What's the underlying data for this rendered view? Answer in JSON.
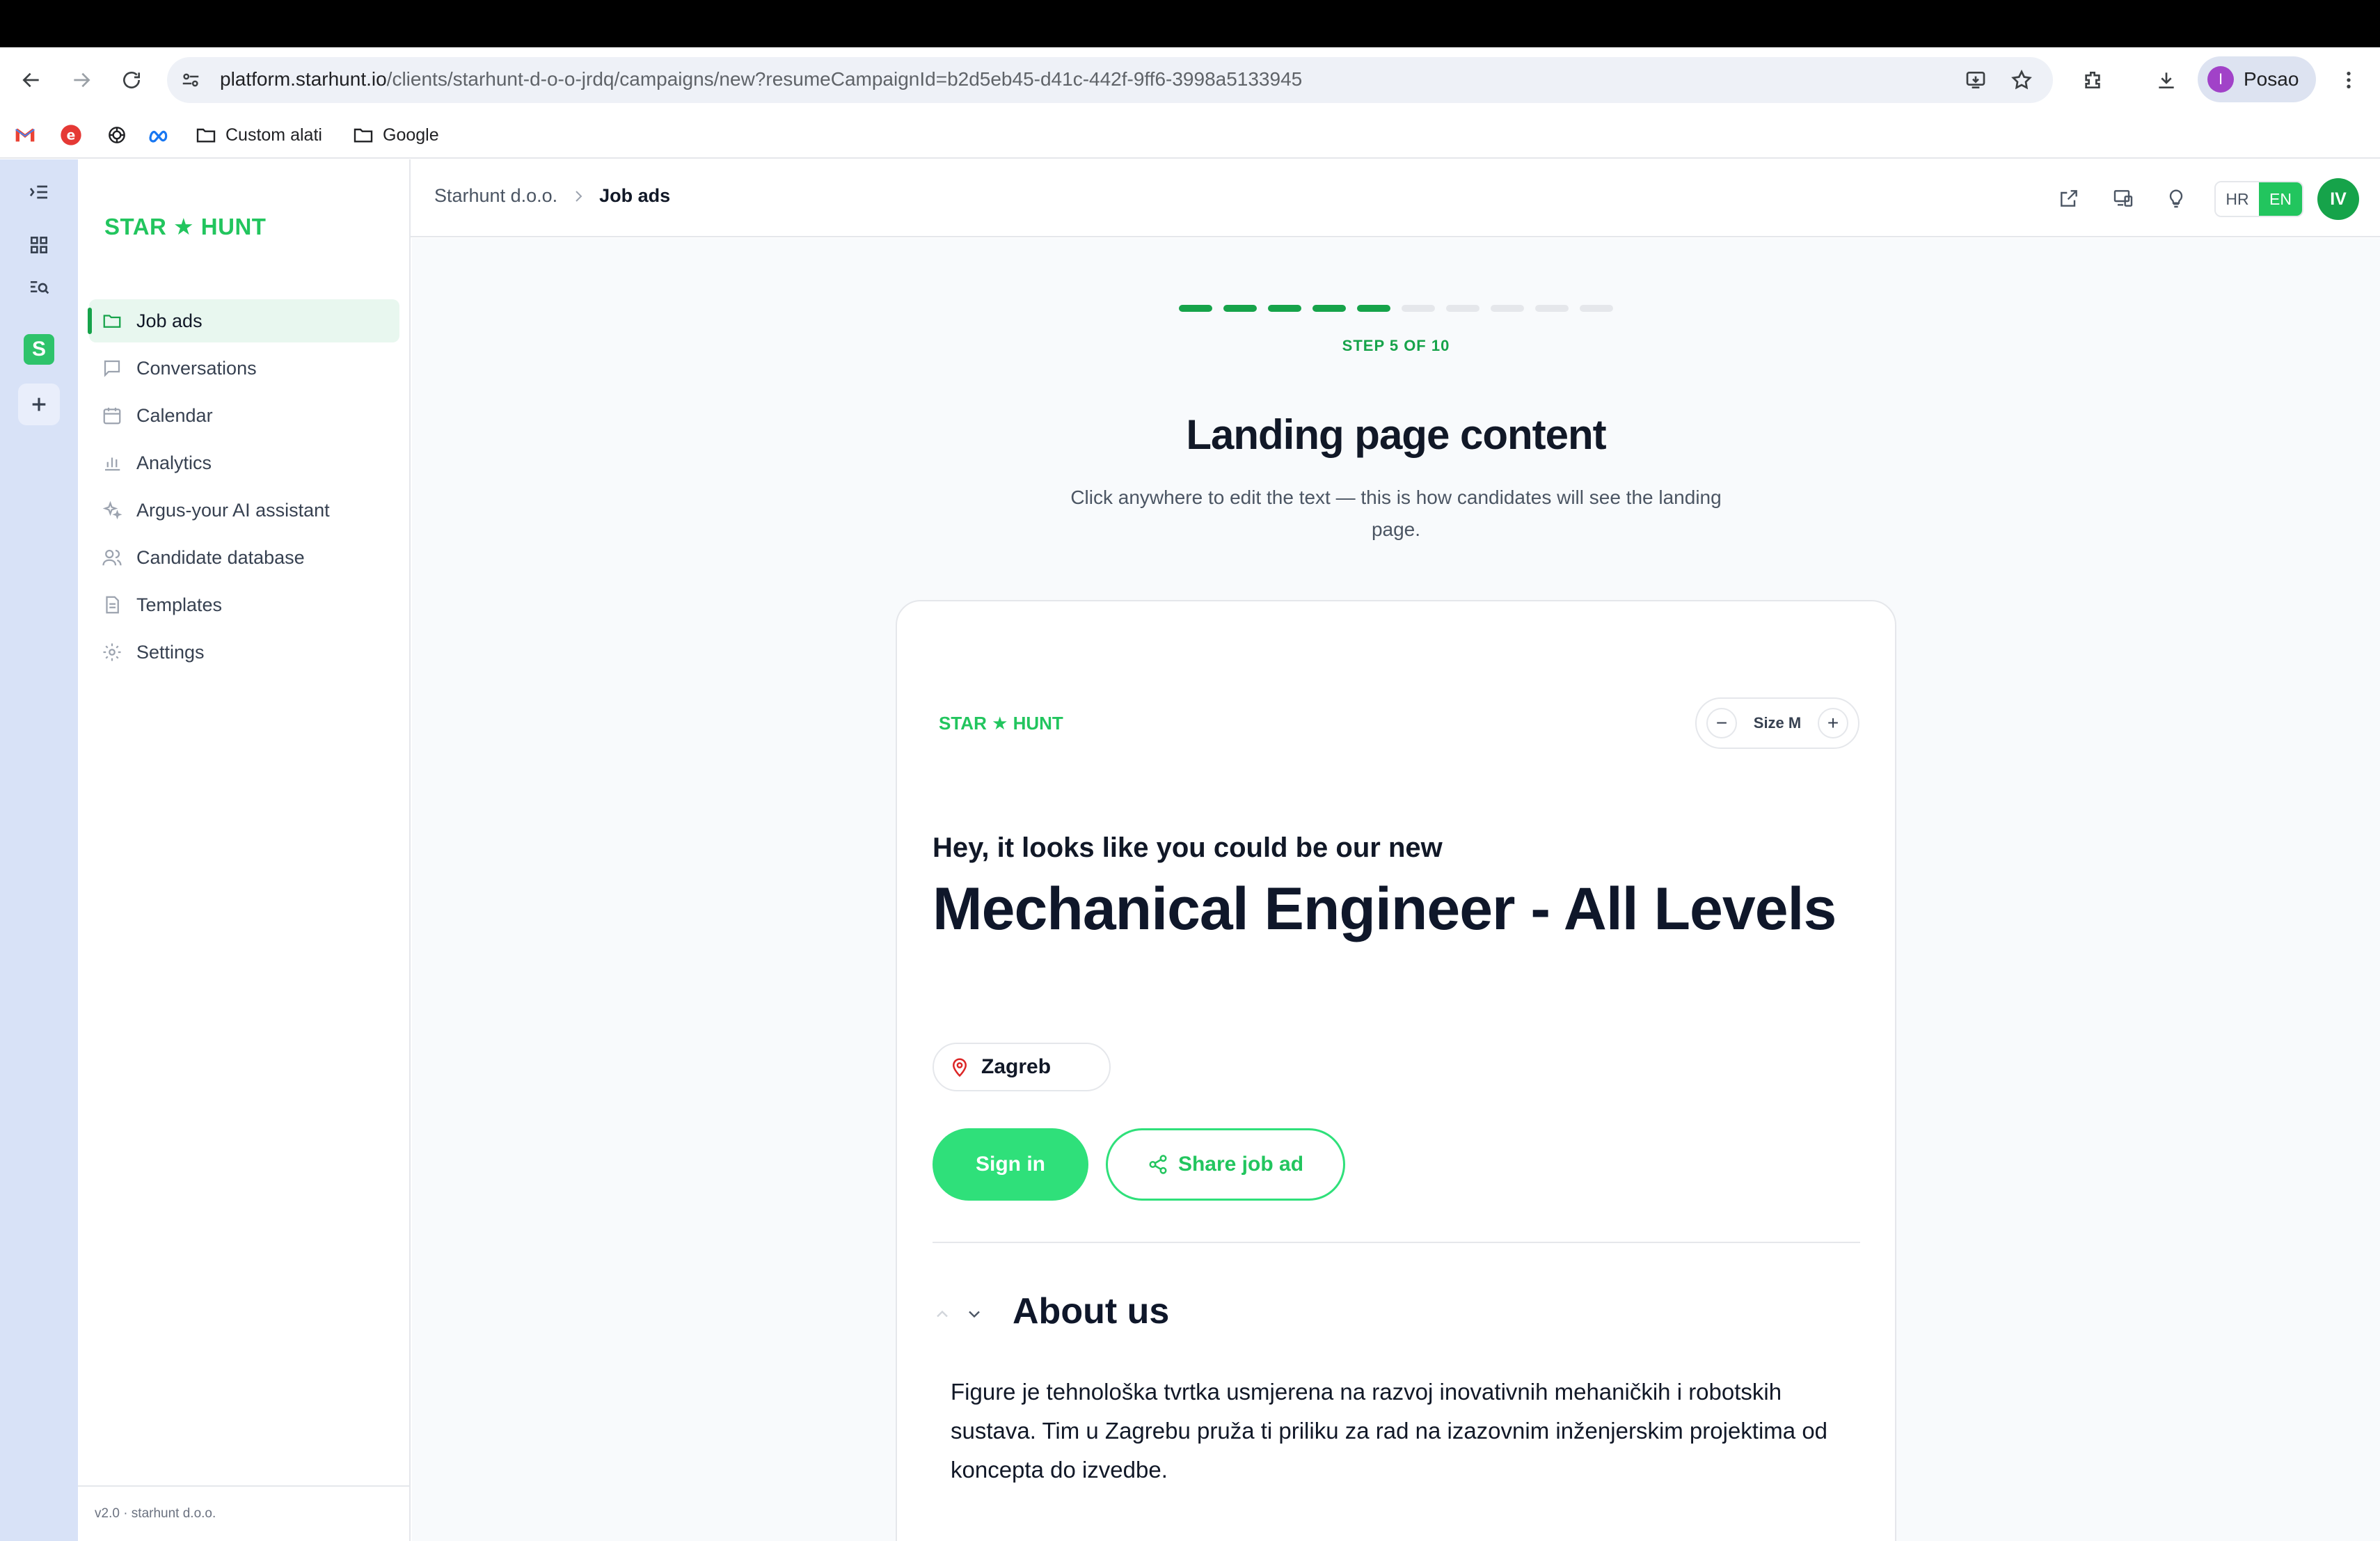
{
  "browser": {
    "url_host": "platform.starhunt.io",
    "url_path": "/clients/starhunt-d-o-o-jrdq/campaigns/new?resumeCampaignId=b2d5eb45-d41c-442f-9ff6-3998a5133945",
    "profile_initial": "I",
    "profile_name": "Posao",
    "bookmarks": [
      {
        "label": "",
        "icon": "gmail-icon"
      },
      {
        "label": "",
        "icon": "e-icon"
      },
      {
        "label": "",
        "icon": "openai-icon"
      },
      {
        "label": "",
        "icon": "meta-icon"
      },
      {
        "label": "Custom alati",
        "icon": "folder-icon"
      },
      {
        "label": "Google",
        "icon": "folder-icon"
      }
    ]
  },
  "rail": {
    "workspace_letter": "S"
  },
  "sidebar": {
    "brand": "STAR ★ HUNT",
    "items": [
      {
        "label": "Job ads",
        "icon": "folder-icon",
        "active": true
      },
      {
        "label": "Conversations",
        "icon": "chat-icon"
      },
      {
        "label": "Calendar",
        "icon": "calendar-icon"
      },
      {
        "label": "Analytics",
        "icon": "bar-chart-icon"
      },
      {
        "label": "Argus-your AI assistant",
        "icon": "sparkles-icon"
      },
      {
        "label": "Candidate database",
        "icon": "users-icon"
      },
      {
        "label": "Templates",
        "icon": "document-icon"
      },
      {
        "label": "Settings",
        "icon": "gear-icon"
      }
    ],
    "footer": "v2.0 · starhunt d.o.o."
  },
  "header": {
    "breadcrumb": [
      "Starhunt d.o.o.",
      "Job ads"
    ],
    "lang_options": [
      "HR",
      "EN"
    ],
    "lang_selected": "EN",
    "user_initials": "IV"
  },
  "wizard": {
    "current_step": 5,
    "total_steps": 10,
    "step_label": "STEP 5 OF 10",
    "title": "Landing page content",
    "subtitle": "Click anywhere to edit the text — this is how candidates will see the landing page."
  },
  "preview": {
    "brand": "STAR ★ HUNT",
    "size_label": "Size M",
    "size_minus": "−",
    "size_plus": "+",
    "greeting": "Hey, it looks like you could be our new",
    "job_title": "Mechanical Engineer - All Levels",
    "location": "Zagreb",
    "signin_label": "Sign in",
    "share_label": "Share job ad",
    "about_title": "About us",
    "about_text": "Figure je tehnološka tvrtka usmjerena na razvoj inovativnih mehaničkih i robotskih sustava. Tim u Zagrebu pruža ti priliku za rad na izazovnim inženjerskim projektima od koncepta do izvedbe."
  },
  "colors": {
    "brand_green": "#22c55e",
    "accent_green": "#16a34a",
    "button_green": "#2fe07a",
    "rail_blue": "#d8e2f7"
  }
}
